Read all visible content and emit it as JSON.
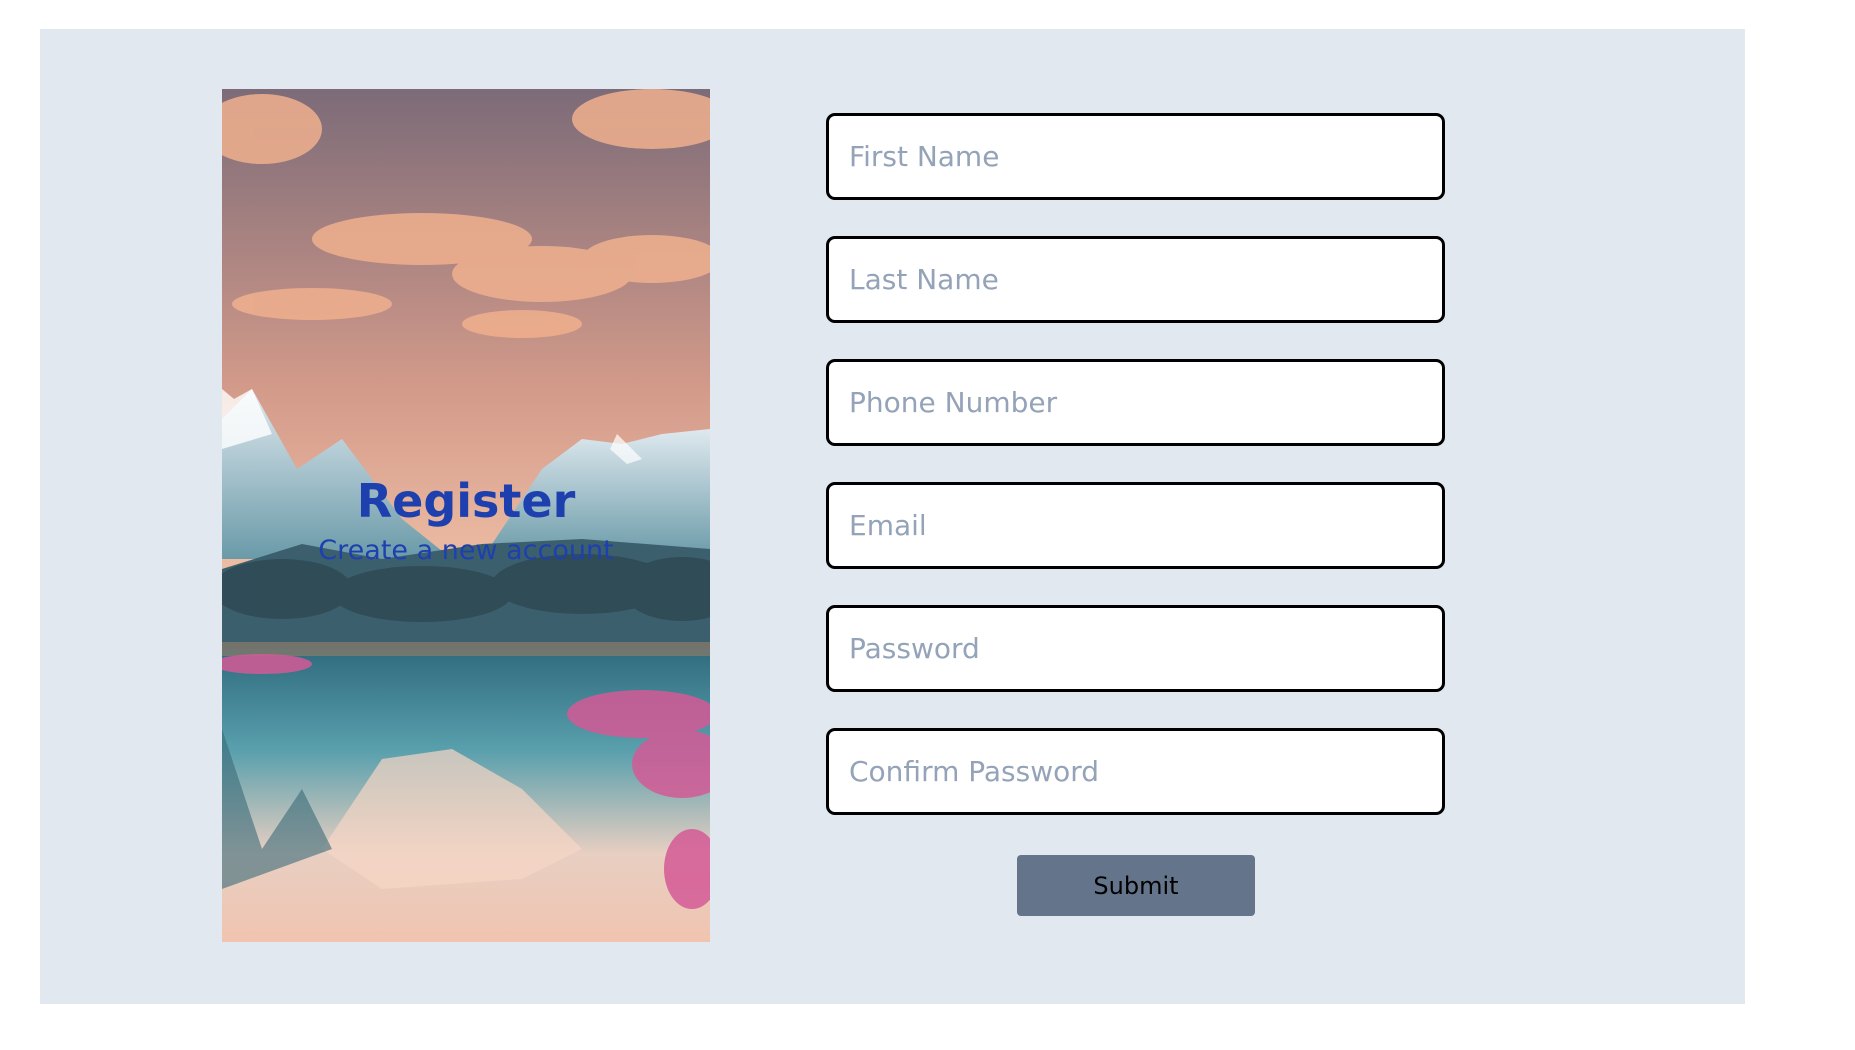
{
  "hero": {
    "title": "Register",
    "subtitle": "Create a new account",
    "image": "mountain-lake-landscape"
  },
  "form": {
    "fields": [
      {
        "placeholder": "First Name",
        "value": ""
      },
      {
        "placeholder": "Last Name",
        "value": ""
      },
      {
        "placeholder": "Phone Number",
        "value": ""
      },
      {
        "placeholder": "Email",
        "value": ""
      },
      {
        "placeholder": "Password",
        "value": ""
      },
      {
        "placeholder": "Confirm Password",
        "value": ""
      }
    ],
    "submit_label": "Submit"
  },
  "colors": {
    "panel_bg": "#e2e8f0",
    "title": "#1e40af",
    "button_bg": "#64748b"
  }
}
